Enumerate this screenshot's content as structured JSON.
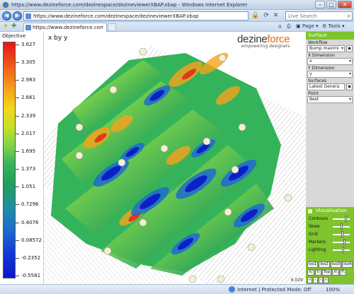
{
  "window": {
    "title": "https://www.dezineforce.com/dezinespace/dezineviewerXBAP.xbap - Windows Internet Explorer"
  },
  "address": {
    "url": "https://www.dezineforce.com/dezinespace/dezineviewerXBAP.xbap",
    "search_placeholder": "Live Search"
  },
  "tabs": [
    {
      "label": "https://www.dezineforce.com/dezinespace/dezi..."
    }
  ],
  "commands": {
    "page": "Page",
    "tools": "Tools"
  },
  "legend": {
    "title": "Objective",
    "values": [
      "3.627",
      "3.305",
      "2.983",
      "2.661",
      "2.339",
      "2.017",
      "1.695",
      "1.373",
      "1.051",
      "0.7296",
      "0.4076",
      "0.08572",
      "-0.2352",
      "-0.5581"
    ]
  },
  "plot": {
    "title": "x by y",
    "version": "6.029"
  },
  "logo": {
    "main_a": "dezine",
    "main_b": "force",
    "tagline": "empowering designers"
  },
  "panel": {
    "header": "Surface",
    "workflow_label": "Workflow",
    "workflow_value": "Bump maximi",
    "xdim_label": "X Dimension",
    "xdim_value": "x",
    "ydim_label": "Y Dimension",
    "ydim_value": "y",
    "surfaces_label": "Surfaces",
    "surfaces_value": "Latest Genera",
    "point_label": "Point",
    "point_value": "Best"
  },
  "visualisation": {
    "header": "Visualisation",
    "sliders": [
      {
        "label": "Contours",
        "level": 0.75
      },
      {
        "label": "Skew",
        "level": 0.5
      },
      {
        "label": "Grid",
        "level": 0.55
      },
      {
        "label": "Markers",
        "level": 0.7
      },
      {
        "label": "Lighting",
        "level": 0.6
      }
    ],
    "row1": [
      "Iso1",
      "Iso2",
      "Iso3",
      "Iso4"
    ],
    "row2": [
      "X/",
      "Y/",
      "Top",
      "X\\",
      "Y\\"
    ]
  },
  "status": {
    "zone": "Internet | Protected Mode: Off",
    "zoom": "100%"
  },
  "colors": {
    "accent_green": "#7cc42a",
    "high": "#e4151a",
    "low": "#0a16c8"
  }
}
